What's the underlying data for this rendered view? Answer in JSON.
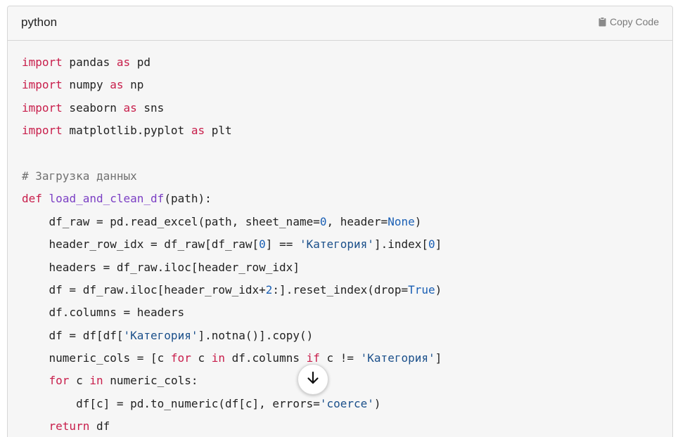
{
  "header": {
    "language": "python",
    "copy_label": "Copy Code",
    "copy_icon": "clipboard-icon"
  },
  "code_lines": [
    [
      {
        "t": "import",
        "c": "kw"
      },
      {
        "t": " pandas "
      },
      {
        "t": "as",
        "c": "kw"
      },
      {
        "t": " pd"
      }
    ],
    [
      {
        "t": "import",
        "c": "kw"
      },
      {
        "t": " numpy "
      },
      {
        "t": "as",
        "c": "kw"
      },
      {
        "t": " np"
      }
    ],
    [
      {
        "t": "import",
        "c": "kw"
      },
      {
        "t": " seaborn "
      },
      {
        "t": "as",
        "c": "kw"
      },
      {
        "t": " sns"
      }
    ],
    [
      {
        "t": "import",
        "c": "kw"
      },
      {
        "t": " matplotlib.pyplot "
      },
      {
        "t": "as",
        "c": "kw"
      },
      {
        "t": " plt"
      }
    ],
    [],
    [
      {
        "t": "# Загрузка данных",
        "c": "cm"
      }
    ],
    [
      {
        "t": "def",
        "c": "kw"
      },
      {
        "t": " "
      },
      {
        "t": "load_and_clean_df",
        "c": "fn"
      },
      {
        "t": "(path):"
      }
    ],
    [
      {
        "t": "    df_raw = pd.read_excel(path, sheet_name="
      },
      {
        "t": "0",
        "c": "num"
      },
      {
        "t": ", header="
      },
      {
        "t": "None",
        "c": "num"
      },
      {
        "t": ")"
      }
    ],
    [
      {
        "t": "    header_row_idx = df_raw[df_raw["
      },
      {
        "t": "0",
        "c": "num"
      },
      {
        "t": "] == "
      },
      {
        "t": "'Категория'",
        "c": "str"
      },
      {
        "t": "].index["
      },
      {
        "t": "0",
        "c": "num"
      },
      {
        "t": "]"
      }
    ],
    [
      {
        "t": "    headers = df_raw.iloc[header_row_idx]"
      }
    ],
    [
      {
        "t": "    df = df_raw.iloc[header_row_idx+"
      },
      {
        "t": "2",
        "c": "num"
      },
      {
        "t": ":].reset_index(drop="
      },
      {
        "t": "True",
        "c": "num"
      },
      {
        "t": ")"
      }
    ],
    [
      {
        "t": "    df.columns = headers"
      }
    ],
    [
      {
        "t": "    df = df[df["
      },
      {
        "t": "'Категория'",
        "c": "str"
      },
      {
        "t": "].notna()].copy()"
      }
    ],
    [
      {
        "t": "    numeric_cols = [c "
      },
      {
        "t": "for",
        "c": "kw"
      },
      {
        "t": " c "
      },
      {
        "t": "in",
        "c": "kw"
      },
      {
        "t": " df.columns "
      },
      {
        "t": "if",
        "c": "kw"
      },
      {
        "t": " c != "
      },
      {
        "t": "'Категория'",
        "c": "str"
      },
      {
        "t": "]"
      }
    ],
    [
      {
        "t": "    "
      },
      {
        "t": "for",
        "c": "kw"
      },
      {
        "t": " c "
      },
      {
        "t": "in",
        "c": "kw"
      },
      {
        "t": " numeric_cols:"
      }
    ],
    [
      {
        "t": "        df[c] = pd.to_numeric(df[c], errors="
      },
      {
        "t": "'coerce'",
        "c": "str"
      },
      {
        "t": ")"
      }
    ],
    [
      {
        "t": "    "
      },
      {
        "t": "return",
        "c": "kw"
      },
      {
        "t": " df"
      }
    ]
  ],
  "scroll_button": {
    "icon": "arrow-down-icon"
  }
}
